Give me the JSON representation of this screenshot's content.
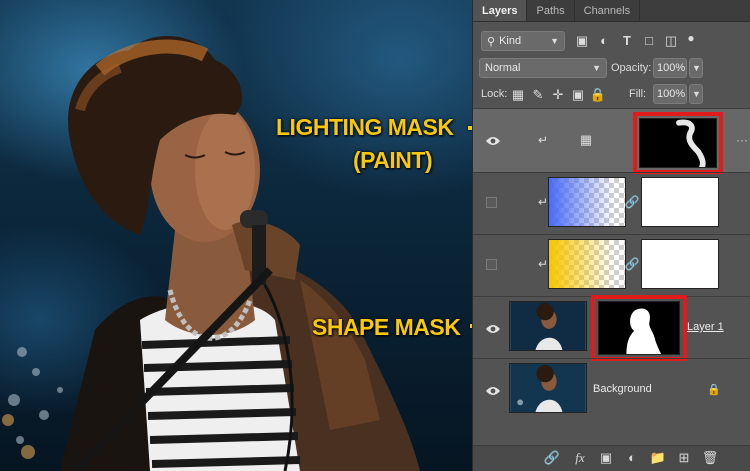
{
  "panel": {
    "tabs": [
      {
        "label": "Layers",
        "active": true
      },
      {
        "label": "Paths",
        "active": false
      },
      {
        "label": "Channels",
        "active": false
      }
    ],
    "filter": {
      "label": "Kind"
    },
    "blend_mode": "Normal",
    "opacity_label": "Opacity:",
    "opacity_value": "100%",
    "lock_label": "Lock:",
    "fill_label": "Fill:",
    "fill_value": "100%",
    "layers": [
      {
        "name": "",
        "visible": true,
        "selected": true,
        "clipped": true,
        "kind": "adjustment",
        "mask": "lighting"
      },
      {
        "name": "",
        "visible": false,
        "selected": false,
        "clipped": true,
        "kind": "gradient",
        "gradient_color": "#4a6cf5"
      },
      {
        "name": "",
        "visible": false,
        "selected": false,
        "clipped": true,
        "kind": "gradient",
        "gradient_color": "#f7c600"
      },
      {
        "name": "Layer 1",
        "visible": true,
        "selected": false,
        "clipped": false,
        "kind": "pixel",
        "mask": "shape"
      },
      {
        "name": "Background",
        "visible": true,
        "selected": false,
        "clipped": false,
        "kind": "pixel",
        "locked": true
      }
    ]
  },
  "annotations": {
    "lighting_title": "LIGHTING MASK",
    "lighting_sub": "(PAINT)",
    "shape_title": "SHAPE MASK",
    "callout_color": "#f6c90e",
    "highlight_color": "#e01b1b"
  },
  "icons": {
    "search": "search-icon",
    "eye": "eye-icon",
    "link": "chain-link-icon",
    "lock": "lock-icon",
    "fx": "fx-icon",
    "mask": "add-mask-icon",
    "adjust": "adjustment-layer-icon",
    "folder": "folder-icon",
    "new": "new-layer-icon",
    "trash": "trash-icon"
  }
}
